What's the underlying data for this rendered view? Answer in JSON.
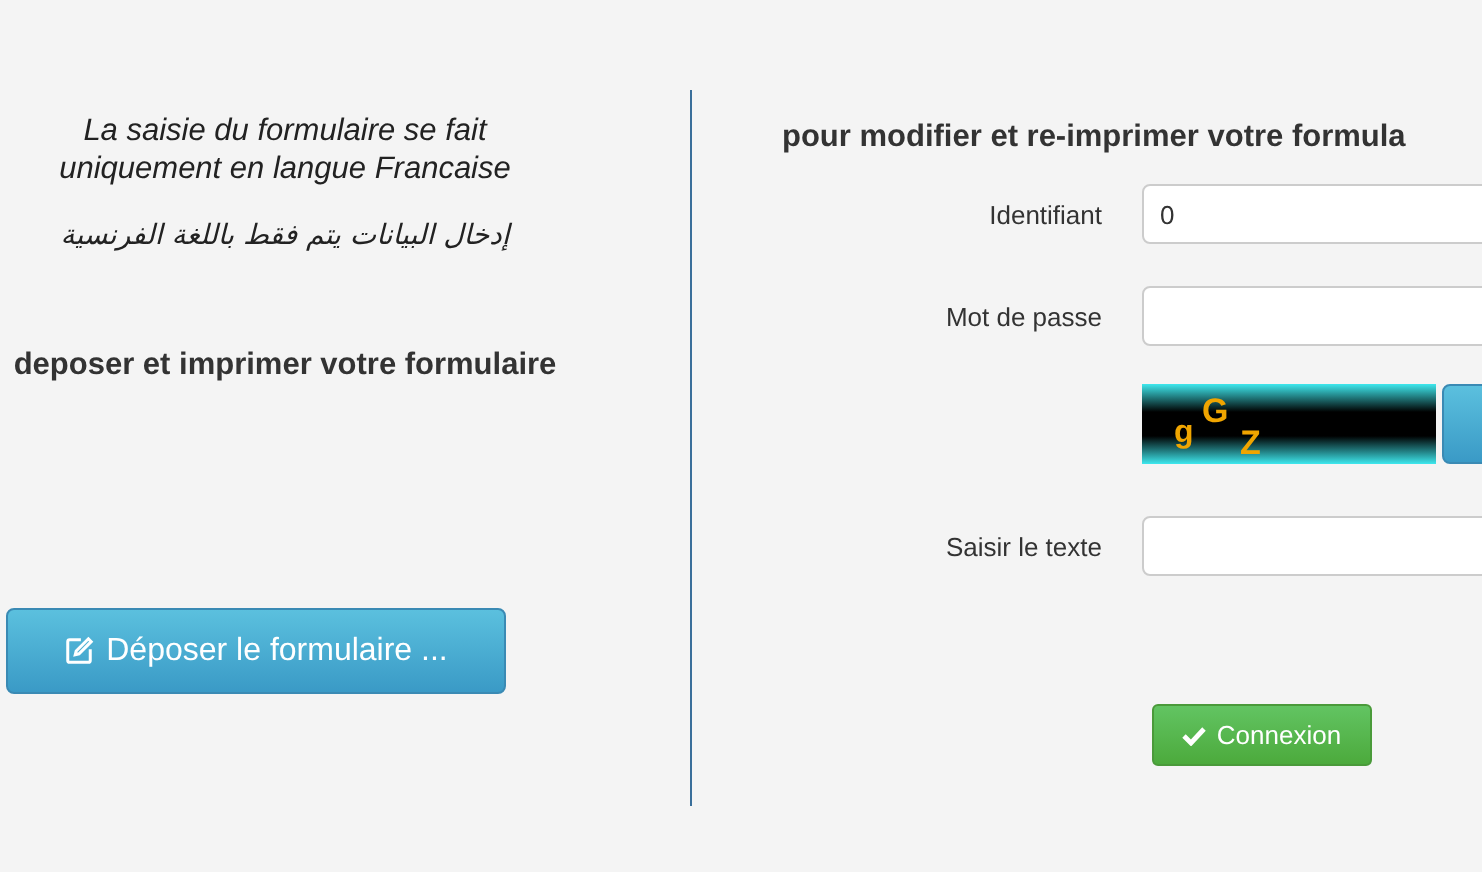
{
  "left": {
    "notice_fr": "La saisie du formulaire se fait uniquement en langue Francaise",
    "notice_ar": "إدخال البيانات يتم فقط باللغة الفرنسية",
    "heading": "deposer et imprimer votre formulaire",
    "button": "Déposer le formulaire ..."
  },
  "right": {
    "heading": "pour modifier et re-imprimer votre formula",
    "fields": [
      {
        "label": "Identifiant",
        "value": "0",
        "kind": "text"
      },
      {
        "label": "Mot de passe",
        "kind": "password"
      },
      {
        "kind": "captcha",
        "captcha": [
          "g",
          "G",
          "Z"
        ]
      },
      {
        "label": "Saisir le texte",
        "kind": "text"
      }
    ],
    "button": "Connexion"
  }
}
